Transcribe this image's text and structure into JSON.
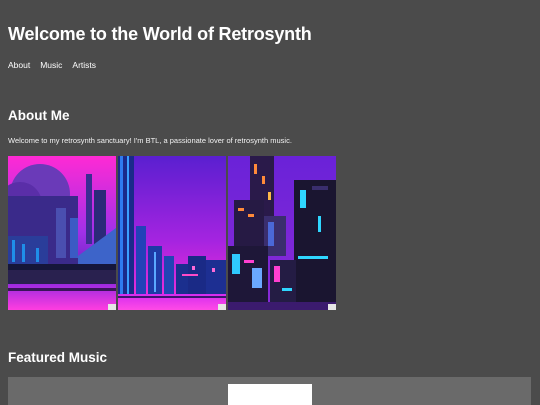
{
  "header": {
    "title": "Welcome to the World of Retrosynth"
  },
  "nav": {
    "items": [
      "About",
      "Music",
      "Artists"
    ]
  },
  "about": {
    "heading": "About Me",
    "intro": "Welcome to my retrosynth sanctuary! I'm BTL, a passionate lover of retrosynth music."
  },
  "gallery": {
    "images": [
      {
        "name": "retrosynth-city-domes-image"
      },
      {
        "name": "retrosynth-neon-skyline-image"
      },
      {
        "name": "retrosynth-towers-image"
      }
    ]
  },
  "music": {
    "heading": "Featured Music"
  },
  "colors": {
    "background": "#4b4b4b",
    "text": "#ffffff",
    "panel": "#6a6a6a",
    "neon_purple": "#7a2bd6",
    "neon_magenta": "#ff1fd0",
    "neon_cyan": "#2ee6ff"
  }
}
